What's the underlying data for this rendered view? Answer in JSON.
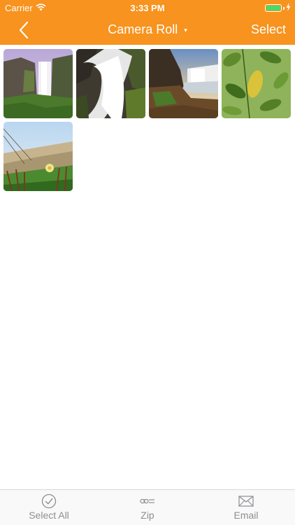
{
  "status_bar": {
    "carrier": "Carrier",
    "time": "3:33 PM",
    "battery_color": "#4cd964"
  },
  "nav": {
    "back_icon": "chevron-left-icon",
    "title": "Camera Roll",
    "title_caret": "▾",
    "select_label": "Select"
  },
  "theme": {
    "accent": "#f7931e"
  },
  "photos": [
    {
      "name": "waterfall-cliff"
    },
    {
      "name": "waterfall-closeup"
    },
    {
      "name": "waterfall-sunset"
    },
    {
      "name": "green-leaves"
    },
    {
      "name": "dune-flower"
    }
  ],
  "tab_bar": {
    "items": [
      {
        "label": "Select All",
        "icon": "checkmark-circle-icon"
      },
      {
        "label": "Zip",
        "icon": "zip-icon"
      },
      {
        "label": "Email",
        "icon": "envelope-icon"
      }
    ]
  }
}
